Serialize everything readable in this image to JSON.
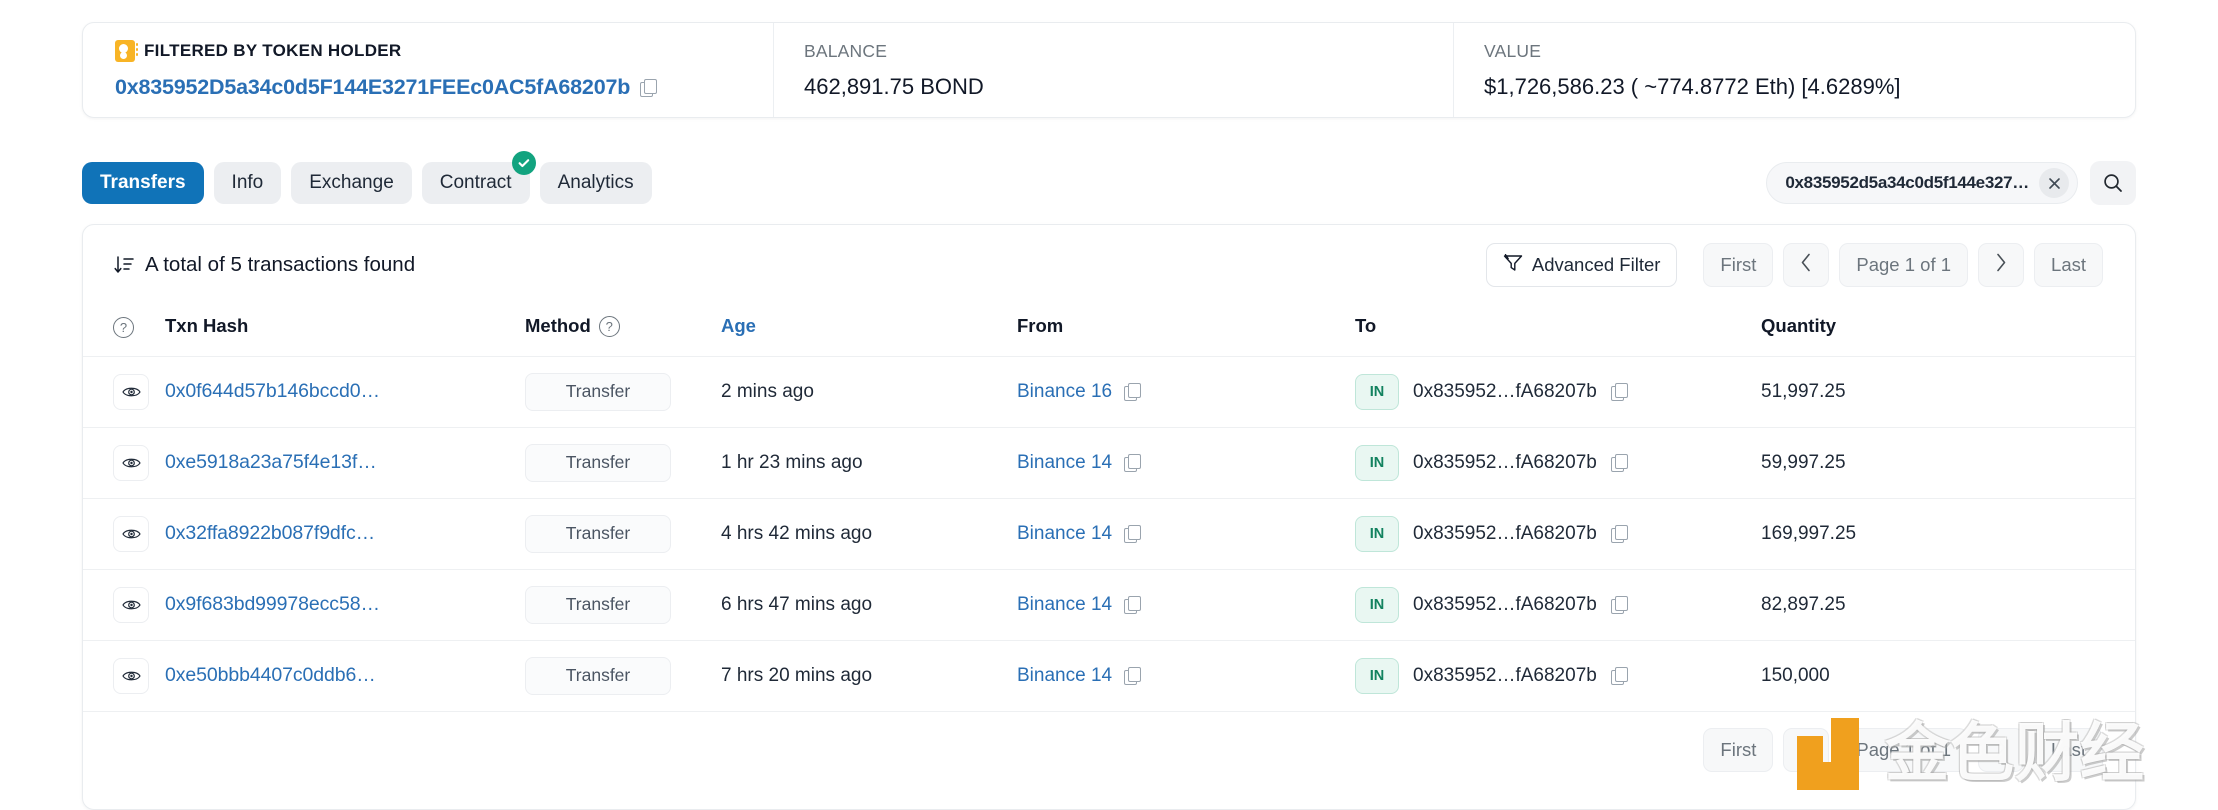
{
  "summary": {
    "filter_label": "FILTERED BY TOKEN HOLDER",
    "filter_address": "0x835952D5a34c0d5F144E3271FEEc0AC5fA68207b",
    "balance_label": "BALANCE",
    "balance_value": "462,891.75 BOND",
    "value_label": "VALUE",
    "value_value": "$1,726,586.23 ( ~774.8772 Eth) [4.6289%]"
  },
  "tabs": [
    {
      "label": "Transfers",
      "active": true,
      "verified": false
    },
    {
      "label": "Info",
      "active": false,
      "verified": false
    },
    {
      "label": "Exchange",
      "active": false,
      "verified": false
    },
    {
      "label": "Contract",
      "active": false,
      "verified": true
    },
    {
      "label": "Analytics",
      "active": false,
      "verified": false
    }
  ],
  "search": {
    "value": "0x835952d5a34c0d5f144e327…",
    "clear_label": "×"
  },
  "toolbar": {
    "total_text": "A total of 5 transactions found",
    "advanced_filter": "Advanced Filter",
    "first": "First",
    "prev": "‹",
    "page_of": "Page 1 of 1",
    "next": "›",
    "last": "Last"
  },
  "table": {
    "headers": {
      "eye": "",
      "txn_hash": "Txn Hash",
      "method": "Method",
      "age": "Age",
      "from": "From",
      "to": "To",
      "quantity": "Quantity"
    },
    "rows": [
      {
        "hash": "0x0f644d57b146bccd0…",
        "method": "Transfer",
        "age": "2 mins ago",
        "from": "Binance 16",
        "direction": "IN",
        "to": "0x835952…fA68207b",
        "quantity": "51,997.25"
      },
      {
        "hash": "0xe5918a23a75f4e13f…",
        "method": "Transfer",
        "age": "1 hr 23 mins ago",
        "from": "Binance 14",
        "direction": "IN",
        "to": "0x835952…fA68207b",
        "quantity": "59,997.25"
      },
      {
        "hash": "0x32ffa8922b087f9dfc…",
        "method": "Transfer",
        "age": "4 hrs 42 mins ago",
        "from": "Binance 14",
        "direction": "IN",
        "to": "0x835952…fA68207b",
        "quantity": "169,997.25"
      },
      {
        "hash": "0x9f683bd99978ecc58…",
        "method": "Transfer",
        "age": "6 hrs 47 mins ago",
        "from": "Binance 14",
        "direction": "IN",
        "to": "0x835952…fA68207b",
        "quantity": "82,897.25"
      },
      {
        "hash": "0xe50bbb4407c0ddb6…",
        "method": "Transfer",
        "age": "7 hrs 20 mins ago",
        "from": "Binance 14",
        "direction": "IN",
        "to": "0x835952…fA68207b",
        "quantity": "150,000"
      }
    ]
  },
  "bottom_pager": {
    "first": "First",
    "prev": "‹",
    "page_of": "Page 1 of 1",
    "next": "›",
    "last": "Last"
  },
  "watermark": {
    "text": "金色财经"
  },
  "colors": {
    "accent_blue": "#1073b8",
    "link_blue": "#2a6fb5",
    "badge_green": "#12825f",
    "verified_green": "#12a37f",
    "watermark_orange": "#f0a01e",
    "filter_icon_orange": "#f8b425"
  }
}
